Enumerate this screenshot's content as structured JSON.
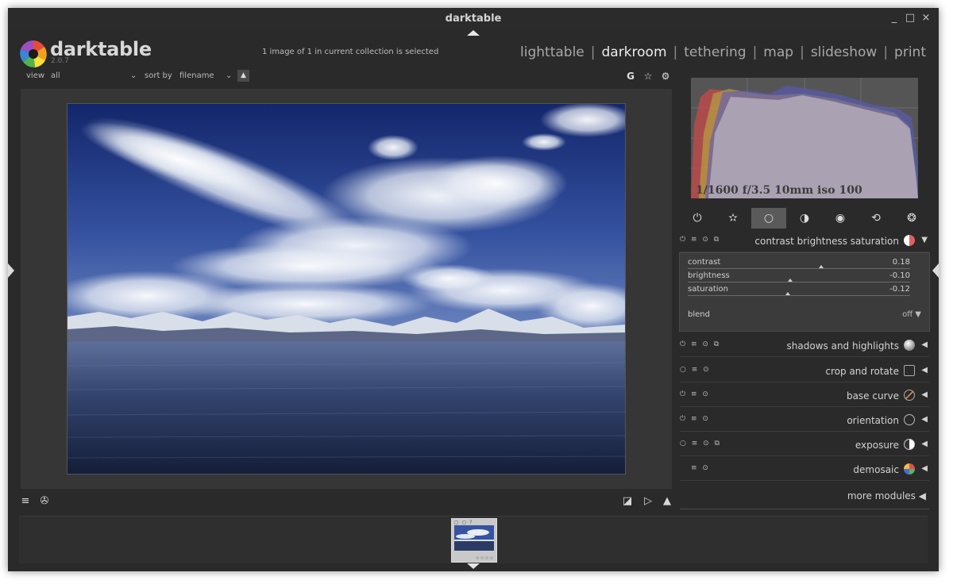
{
  "window": {
    "title": "darktable",
    "minimize": "_",
    "maximize": "□",
    "close": "×"
  },
  "app": {
    "name": "darktable",
    "version": "2.0.7"
  },
  "status": {
    "selection_message": "1 image of 1 in current collection is selected"
  },
  "views": {
    "items": [
      {
        "label": "lighttable",
        "active": false
      },
      {
        "label": "darkroom",
        "active": true
      },
      {
        "label": "tethering",
        "active": false
      },
      {
        "label": "map",
        "active": false
      },
      {
        "label": "slideshow",
        "active": false
      },
      {
        "label": "print",
        "active": false
      }
    ],
    "separator": "|"
  },
  "filter": {
    "view_label": "view",
    "view_value": "all",
    "sort_label": "sort by",
    "sort_value": "filename",
    "sort_order_icon": "▲"
  },
  "top_toolbar": {
    "grouping_icon": "G",
    "star_icon": "☆",
    "gear_icon": "⚙"
  },
  "histogram": {
    "exif": "1/1600 f/3.5 10mm iso 100"
  },
  "module_groups": [
    {
      "icon": "power-icon",
      "glyph": "⏻",
      "active": false
    },
    {
      "icon": "favorites-icon",
      "glyph": "✫",
      "active": false
    },
    {
      "icon": "basic-group-icon",
      "glyph": "○",
      "active": true
    },
    {
      "icon": "tone-group-icon",
      "glyph": "◑",
      "active": false
    },
    {
      "icon": "color-group-icon",
      "glyph": "◉",
      "active": false
    },
    {
      "icon": "correct-group-icon",
      "glyph": "⟲",
      "active": false
    },
    {
      "icon": "effect-group-icon",
      "glyph": "❂",
      "active": false
    }
  ],
  "modules": [
    {
      "name": "contrast brightness saturation",
      "header_icons": "⏻ ≡ ⊙ ⧉",
      "icon": "contrast-brightness-icon",
      "icon_color": "#e06060",
      "arrow": "▼"
    },
    {
      "name": "shadows and highlights",
      "header_icons": "⏻ ≡ ⊙ ⧉",
      "icon": "shadows-highlights-icon",
      "icon_color": "#9a9a9a",
      "arrow": "◀"
    },
    {
      "name": "crop and rotate",
      "header_icons": "○ ≡ ⊙",
      "icon": "crop-rotate-icon",
      "icon_color": "#9a9a9a",
      "arrow": "◀"
    },
    {
      "name": "base curve",
      "header_icons": "⏻ ≡ ⊙",
      "icon": "base-curve-icon",
      "icon_color": "#d88040",
      "arrow": "◀"
    },
    {
      "name": "orientation",
      "header_icons": "⏻ ≡ ⊙",
      "icon": "orientation-icon",
      "icon_color": "#9a9a9a",
      "arrow": "◀"
    },
    {
      "name": "exposure",
      "header_icons": "○ ≡ ⊙ ⧉",
      "icon": "exposure-icon",
      "icon_color": "#e0e0e0",
      "arrow": "◀"
    },
    {
      "name": "demosaic",
      "header_icons": "≡ ⊙",
      "icon": "demosaic-icon",
      "icon_color": "#60b060",
      "arrow": "◀"
    }
  ],
  "cbs_panel": {
    "sliders": [
      {
        "label": "contrast",
        "value": "0.18",
        "position": 0.59
      },
      {
        "label": "brightness",
        "value": "-0.10",
        "position": 0.45
      },
      {
        "label": "saturation",
        "value": "-0.12",
        "position": 0.44
      }
    ],
    "blend_label": "blend",
    "blend_value": "off",
    "blend_arrow": "▼"
  },
  "more_modules": {
    "label": "more modules",
    "arrow": "◀"
  },
  "bottom_toolbar": {
    "menu_icon": "≡",
    "styles_icon": "✇",
    "softproof_icon": "◪",
    "gamutcheck_icon": "▷",
    "warning_icon": "▲"
  },
  "filmstrip": {
    "thumb_dots": "▢ ▢ ?",
    "thumb_stars": "☆☆☆☆"
  },
  "colors": {
    "accent": "#e6e6e6",
    "background": "#2a2a2a",
    "panel": "#363636"
  }
}
